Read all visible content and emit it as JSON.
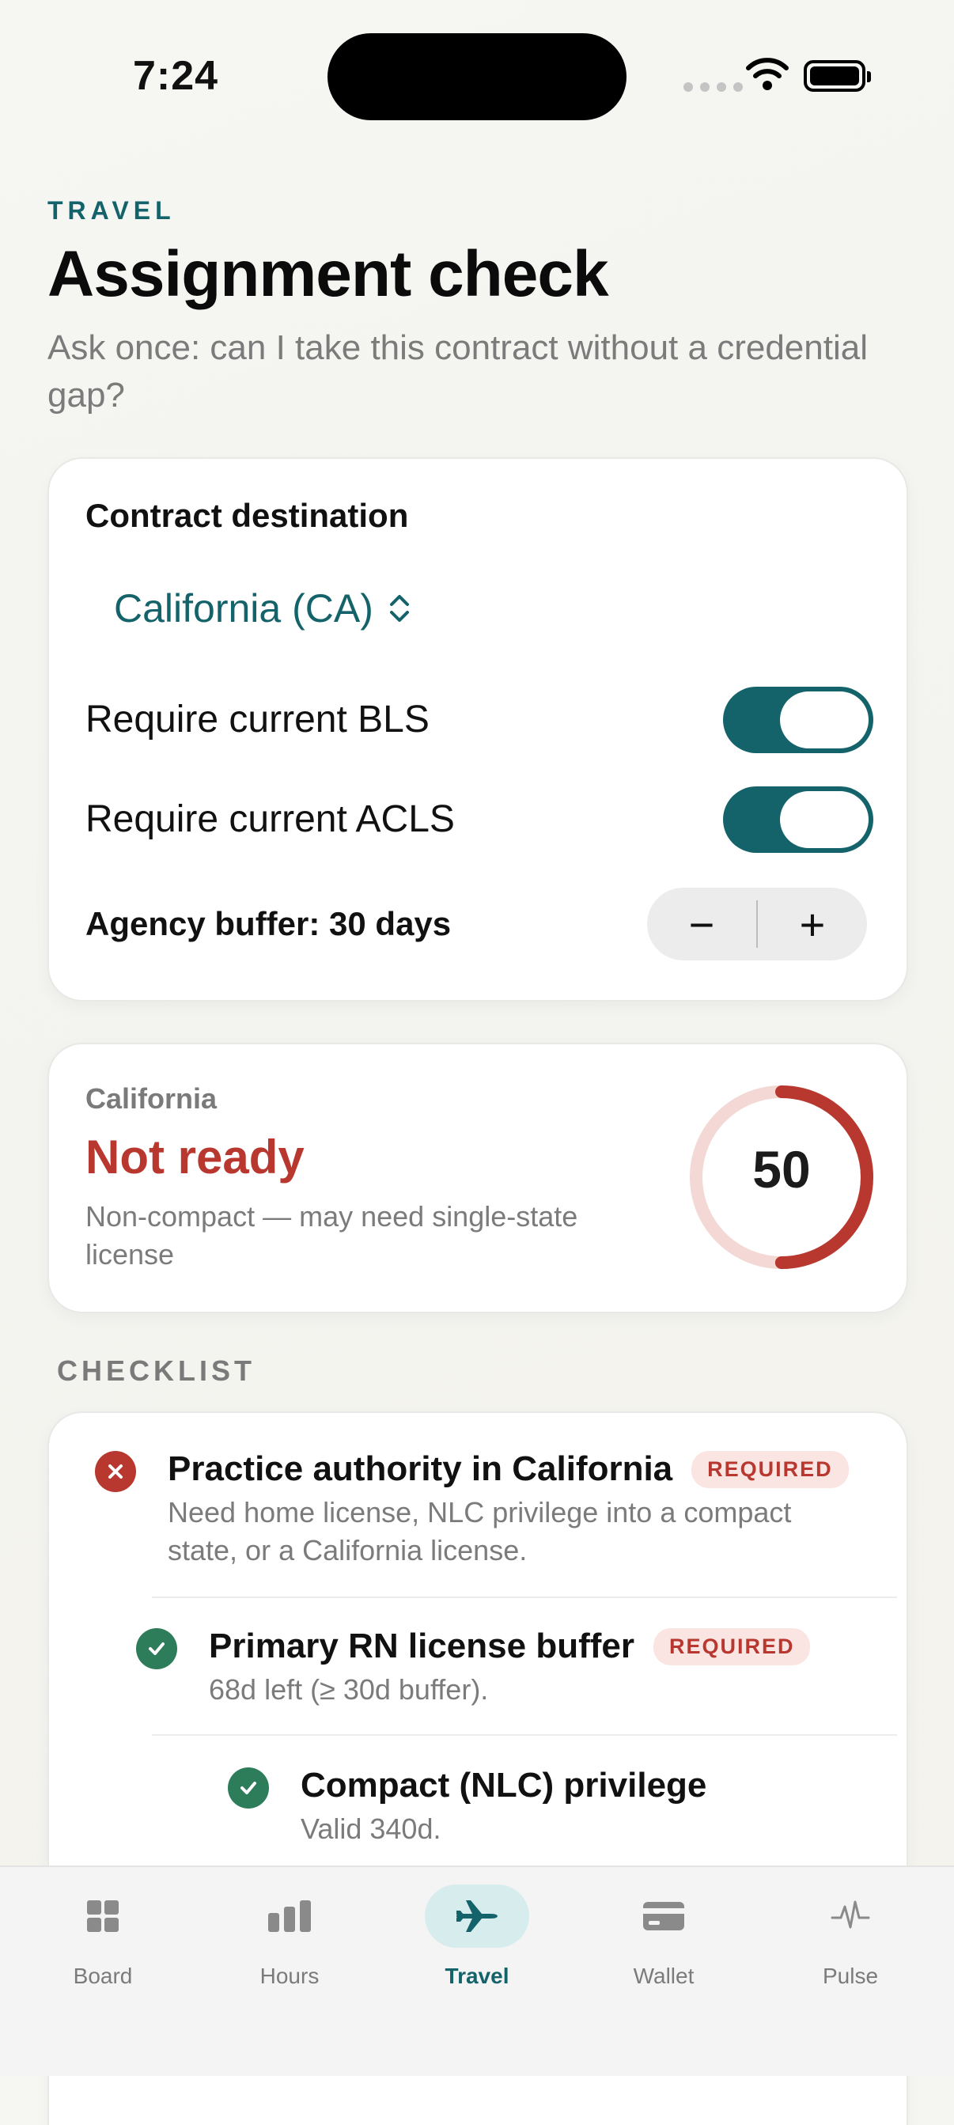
{
  "status_bar": {
    "time": "7:24"
  },
  "header": {
    "eyebrow": "TRAVEL",
    "title": "Assignment check",
    "subtitle": "Ask once: can I take this contract without a credential gap?"
  },
  "destination_card": {
    "label": "Contract destination",
    "selected_state": "California (CA)",
    "require_bls_label": "Require current BLS",
    "require_bls_on": true,
    "require_acls_label": "Require current ACLS",
    "require_acls_on": true,
    "buffer_label": "Agency buffer: 30 days",
    "stepper_minus": "−",
    "stepper_plus": "+"
  },
  "readiness": {
    "state": "California",
    "status": "Not ready",
    "description": "Non-compact — may need single-state license",
    "score": "50",
    "score_fraction": 0.5,
    "colors": {
      "ring": "#b8382f",
      "ring_track": "#f3d8d5"
    }
  },
  "checklist": {
    "heading": "CHECKLIST",
    "items": [
      {
        "title": "Practice authority in California",
        "badge": "REQUIRED",
        "subtitle": "Need home license, NLC privilege into a compact state, or a California license.",
        "status": "fail"
      },
      {
        "title": "Primary RN license buffer",
        "badge": "REQUIRED",
        "subtitle": "68d left (≥ 30d buffer).",
        "status": "ok"
      },
      {
        "title": "Compact (NLC) privilege",
        "badge": "",
        "subtitle": "Valid 340d.",
        "status": "ok"
      }
    ]
  },
  "tabs": [
    {
      "label": "Board",
      "icon": "grid-icon"
    },
    {
      "label": "Hours",
      "icon": "bar-chart-icon"
    },
    {
      "label": "Travel",
      "icon": "airplane-icon",
      "active": true
    },
    {
      "label": "Wallet",
      "icon": "card-icon"
    },
    {
      "label": "Pulse",
      "icon": "pulse-icon"
    }
  ],
  "colors": {
    "accent": "#15636a",
    "danger": "#b8382f",
    "success": "#2e7d5a"
  }
}
